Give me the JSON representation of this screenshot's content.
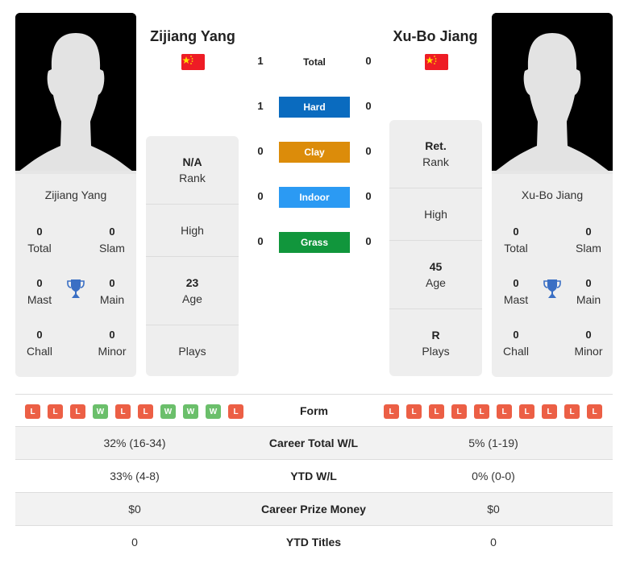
{
  "player1": {
    "name": "Zijiang Yang",
    "flag": "china-flag",
    "titles": {
      "total": "0",
      "slam": "0",
      "mast": "0",
      "main": "0",
      "chall": "0",
      "minor": "0"
    },
    "titles_labels": {
      "total": "Total",
      "slam": "Slam",
      "mast": "Mast",
      "main": "Main",
      "chall": "Chall",
      "minor": "Minor"
    },
    "info": {
      "rank_value": "N/A",
      "rank_label": "Rank",
      "high_value": "",
      "high_label": "High",
      "age_value": "23",
      "age_label": "Age",
      "plays_value": "",
      "plays_label": "Plays"
    },
    "form": [
      "L",
      "L",
      "L",
      "W",
      "L",
      "L",
      "W",
      "W",
      "W",
      "L"
    ]
  },
  "player2": {
    "name": "Xu-Bo Jiang",
    "flag": "china-flag",
    "titles": {
      "total": "0",
      "slam": "0",
      "mast": "0",
      "main": "0",
      "chall": "0",
      "minor": "0"
    },
    "titles_labels": {
      "total": "Total",
      "slam": "Slam",
      "mast": "Mast",
      "main": "Main",
      "chall": "Chall",
      "minor": "Minor"
    },
    "info": {
      "rank_value": "Ret.",
      "rank_label": "Rank",
      "high_value": "",
      "high_label": "High",
      "age_value": "45",
      "age_label": "Age",
      "plays_value": "R",
      "plays_label": "Plays"
    },
    "form": [
      "L",
      "L",
      "L",
      "L",
      "L",
      "L",
      "L",
      "L",
      "L",
      "L"
    ]
  },
  "h2h": [
    {
      "label": "Total",
      "p1": "1",
      "p2": "0",
      "color": ""
    },
    {
      "label": "Hard",
      "p1": "1",
      "p2": "0",
      "color": "#0a6bbf"
    },
    {
      "label": "Clay",
      "p1": "0",
      "p2": "0",
      "color": "#dc8c0a"
    },
    {
      "label": "Indoor",
      "p1": "0",
      "p2": "0",
      "color": "#2b9af3"
    },
    {
      "label": "Grass",
      "p1": "0",
      "p2": "0",
      "color": "#11963c"
    }
  ],
  "form_label": "Form",
  "stats": [
    {
      "label": "Career Total W/L",
      "p1": "32% (16-34)",
      "p2": "5% (1-19)"
    },
    {
      "label": "YTD W/L",
      "p1": "33% (4-8)",
      "p2": "0% (0-0)"
    },
    {
      "label": "Career Prize Money",
      "p1": "$0",
      "p2": "$0"
    },
    {
      "label": "YTD Titles",
      "p1": "0",
      "p2": "0"
    }
  ]
}
